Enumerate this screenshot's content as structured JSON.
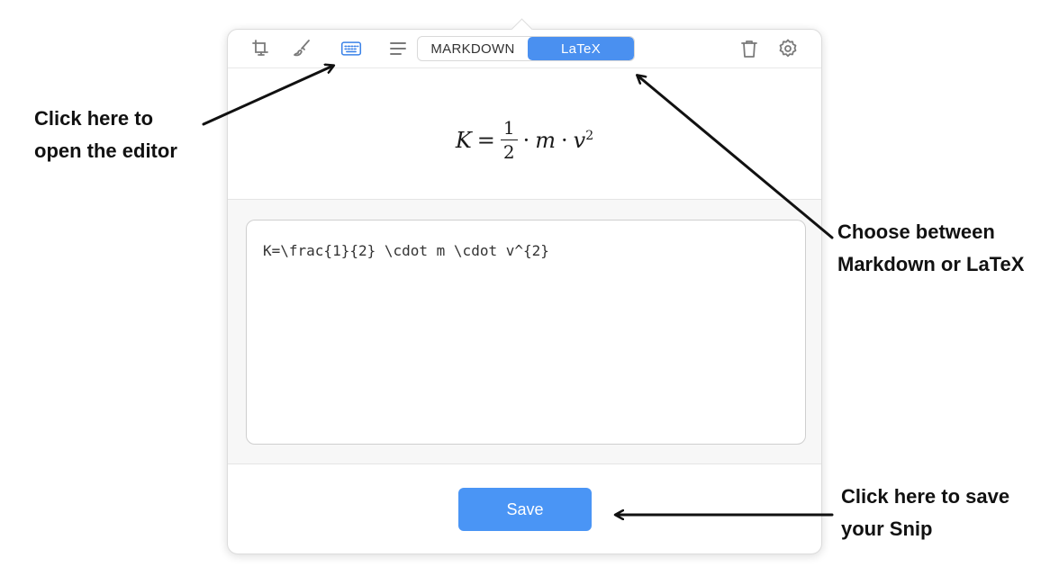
{
  "toolbar": {
    "icons": [
      "crop-screen-icon",
      "pen-draw-icon",
      "keyboard-icon",
      "text-align-icon",
      "trash-icon",
      "gear-icon"
    ],
    "format_tabs": [
      {
        "label": "MARKDOWN",
        "active": false
      },
      {
        "label": "LaTeX",
        "active": true
      }
    ]
  },
  "preview": {
    "lhs": "K",
    "equals": "=",
    "numerator": "1",
    "denominator": "2",
    "dot": "·",
    "m": "m",
    "v": "v",
    "exponent": "2"
  },
  "editor": {
    "value": "K=\\frac{1}{2} \\cdot m \\cdot v^{2}"
  },
  "footer": {
    "save_label": "Save"
  },
  "annotations": {
    "open_editor_line1": "Click here to",
    "open_editor_line2": "open the editor",
    "choose_format_line1": "Choose between",
    "choose_format_line2": "Markdown or LaTeX",
    "save_snip_line1": "Click here to save",
    "save_snip_line2": "your Snip"
  },
  "colors": {
    "accent": "#4a90f0",
    "active_icon": "#3b82e8"
  }
}
